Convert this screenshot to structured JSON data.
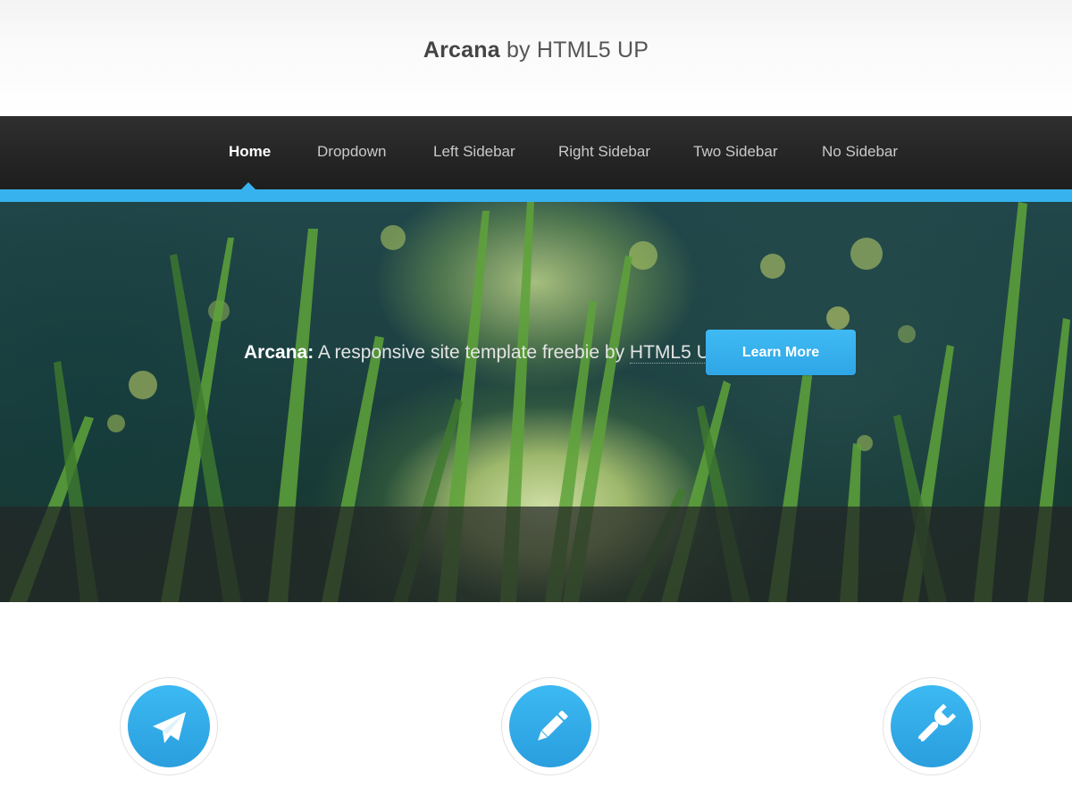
{
  "header": {
    "logo_strong": "Arcana",
    "logo_rest": " by HTML5 UP"
  },
  "nav": {
    "items": [
      {
        "label": "Home",
        "active": true
      },
      {
        "label": "Dropdown",
        "active": false
      },
      {
        "label": "Left Sidebar",
        "active": false
      },
      {
        "label": "Right Sidebar",
        "active": false
      },
      {
        "label": "Two Sidebar",
        "active": false
      },
      {
        "label": "No Sidebar",
        "active": false
      }
    ]
  },
  "banner": {
    "caption_strong": "Arcana:",
    "caption_text": " A responsive site template freebie by ",
    "caption_link": "HTML5 UP",
    "button_label": "Learn More"
  },
  "features": [
    {
      "icon": "paper-plane-icon"
    },
    {
      "icon": "pencil-icon"
    },
    {
      "icon": "wrench-icon"
    }
  ],
  "colors": {
    "accent": "#37b2ef",
    "nav_background": "#262626",
    "logo_text": "#444444"
  }
}
